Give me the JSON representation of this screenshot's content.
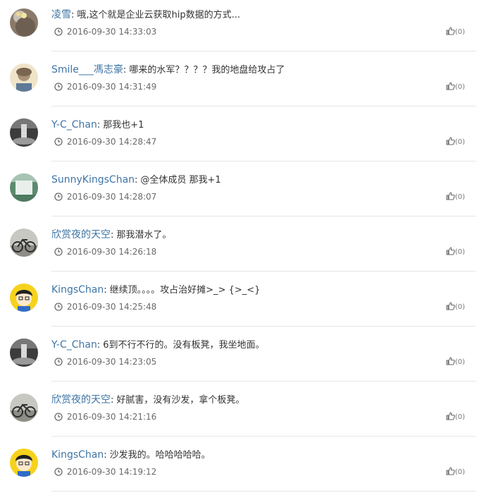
{
  "comments": [
    {
      "name": "凌雪",
      "text": "哦,这个就是企业云获取hip数据的方式...",
      "time": "2016-09-30 14:33:03",
      "likes": "(0)",
      "avatar": "flower-avatar"
    },
    {
      "name": "Smile___馮志豪",
      "text": "哪来的水军？？？？我的地盘给攻占了",
      "time": "2016-09-30 14:31:49",
      "likes": "(0)",
      "avatar": "person-avatar"
    },
    {
      "name": "Y-C_Chan",
      "text": "那我也+1",
      "time": "2016-09-30 14:28:47",
      "likes": "(0)",
      "avatar": "waterfall-dark-avatar"
    },
    {
      "name": "SunnyKingsChan",
      "text": "@全体成员 那我+1",
      "time": "2016-09-30 14:28:07",
      "likes": "(0)",
      "avatar": "waterfall-light-avatar"
    },
    {
      "name": "欣赏夜的天空",
      "text": "那我潜水了。",
      "time": "2016-09-30 14:26:18",
      "likes": "(0)",
      "avatar": "bicycle-avatar"
    },
    {
      "name": "KingsChan",
      "text": "继续顶。。。。攻占治好摊>_> {>_<}",
      "time": "2016-09-30 14:25:48",
      "likes": "(0)",
      "avatar": "cartoon-avatar"
    },
    {
      "name": "Y-C_Chan",
      "text": "6到不行不行的。没有板凳，我坐地面。",
      "time": "2016-09-30 14:23:05",
      "likes": "(0)",
      "avatar": "waterfall-dark-avatar"
    },
    {
      "name": "欣赏夜的天空",
      "text": "好腻害，没有沙发，拿个板凳。",
      "time": "2016-09-30 14:21:16",
      "likes": "(0)",
      "avatar": "bicycle-avatar"
    },
    {
      "name": "KingsChan",
      "text": "沙发我的。哈哈哈哈哈。",
      "time": "2016-09-30 14:19:12",
      "likes": "(0)",
      "avatar": "cartoon-avatar"
    }
  ],
  "colors": {
    "username": "#3e75a6",
    "meta": "#6a6a6a",
    "divider": "#e6e6e6"
  },
  "icons": {
    "time": "clock-icon",
    "like": "thumbs-up-icon"
  }
}
